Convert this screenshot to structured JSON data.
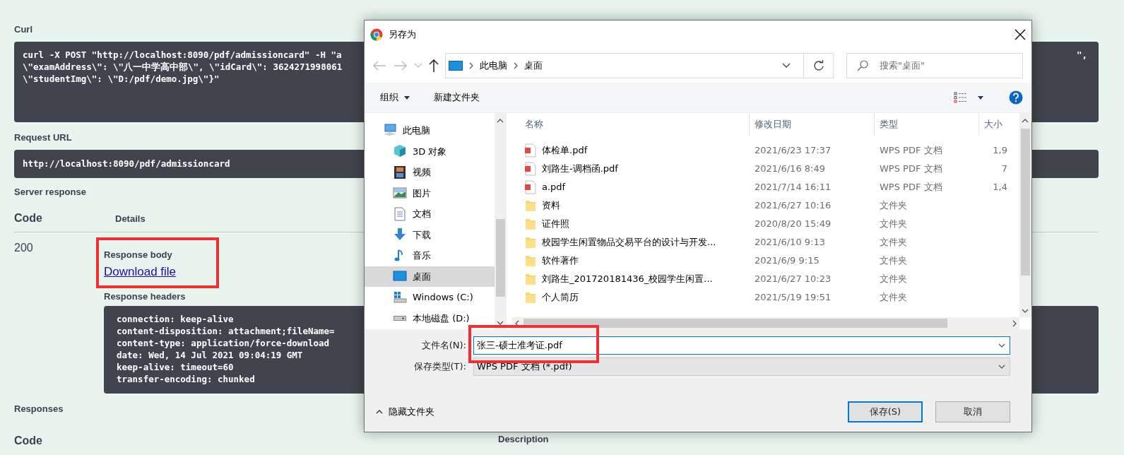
{
  "page": {
    "curl_label": "Curl",
    "curl_lines": [
      "curl -X POST \"http://localhost:8090/pdf/admissioncard\" -H \"a",
      "\\\"examAddress\\\": \\\"八一中学高中部\\\", \\\"idCard\\\": 3624271998061",
      "\\\"studentImg\\\": \\\"D:/pdf/demo.jpg\\\"}\""
    ],
    "curl_tail": "\",",
    "request_url_label": "Request URL",
    "request_url": "http://localhost:8090/pdf/admissioncard",
    "server_response_label": "Server response",
    "columns": [
      "Code",
      "Details"
    ],
    "code": "200",
    "response_body_label": "Response body",
    "download_link": "Download file",
    "response_headers_label": "Response headers",
    "headers": [
      "connection: keep-alive",
      "content-disposition: attachment;fileName=",
      "content-type: application/force-download",
      "date: Wed, 14 Jul 2021 09:04:19 GMT",
      "keep-alive: timeout=60",
      "transfer-encoding: chunked"
    ],
    "responses_label": "Responses",
    "responses_columns": [
      "Code",
      "Description"
    ]
  },
  "dialog": {
    "title": "另存为",
    "path": [
      "此电脑",
      "桌面"
    ],
    "search_placeholder": "搜索\"桌面\"",
    "toolbar": {
      "organize": "组织",
      "new_folder": "新建文件夹"
    },
    "nav": [
      {
        "label": "此电脑",
        "selected": false,
        "children": [
          {
            "label": "3D 对象",
            "selected": false
          },
          {
            "label": "视频",
            "selected": false
          },
          {
            "label": "图片",
            "selected": false
          },
          {
            "label": "文档",
            "selected": false
          },
          {
            "label": "下载",
            "selected": false
          },
          {
            "label": "音乐",
            "selected": false
          },
          {
            "label": "桌面",
            "selected": true
          },
          {
            "label": "Windows (C:)",
            "selected": false
          },
          {
            "label": "本地磁盘 (D:)",
            "selected": false
          }
        ]
      }
    ],
    "columns": [
      "名称",
      "修改日期",
      "类型",
      "大小"
    ],
    "files": [
      {
        "kind": "pdf",
        "name": "体检单.pdf",
        "modified": "2021/6/23 17:37",
        "type": "WPS PDF 文档",
        "size": "1,9"
      },
      {
        "kind": "pdf",
        "name": "刘路生-调档函.pdf",
        "modified": "2021/6/16 8:49",
        "type": "WPS PDF 文档",
        "size": "7"
      },
      {
        "kind": "pdf",
        "name": "a.pdf",
        "modified": "2021/7/14 16:11",
        "type": "WPS PDF 文档",
        "size": "1,4"
      },
      {
        "kind": "folder",
        "name": "资料",
        "modified": "2021/6/27 10:16",
        "type": "文件夹"
      },
      {
        "kind": "folder",
        "name": "证件照",
        "modified": "2020/8/20 15:49",
        "type": "文件夹"
      },
      {
        "kind": "folder",
        "name": "校园学生闲置物品交易平台的设计与开发...",
        "modified": "2021/6/10 9:13",
        "type": "文件夹"
      },
      {
        "kind": "folder",
        "name": "软件著作",
        "modified": "2021/6/9 9:15",
        "type": "文件夹"
      },
      {
        "kind": "folder",
        "name": "刘路生_201720181436_校园学生闲置...",
        "modified": "2021/6/27 10:23",
        "type": "文件夹"
      },
      {
        "kind": "folder",
        "name": "个人简历",
        "modified": "2021/5/19 19:51",
        "type": "文件夹"
      }
    ],
    "filename_label": "文件名(N):",
    "filename": "张三-硕士准考证.pdf",
    "filetype_label": "保存类型(T):",
    "filetype": "WPS PDF 文档 (*.pdf)",
    "hide_folders": "隐藏文件夹",
    "buttons": [
      "保存(S)",
      "取消"
    ]
  }
}
